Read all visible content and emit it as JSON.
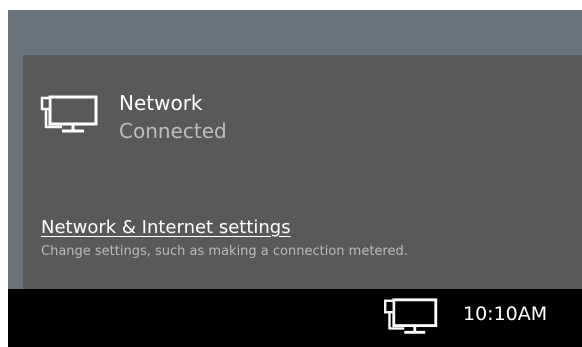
{
  "colors": {
    "desktop": "#68757f",
    "flyout": "#595959",
    "taskbar": "#000000",
    "text_primary": "#ffffff",
    "text_secondary": "#bdbdbd"
  },
  "flyout": {
    "network": {
      "icon": "wired-network-icon",
      "name": "Network",
      "status": "Connected"
    },
    "settings": {
      "link_label": "Network & Internet settings",
      "description": "Change settings, such as making a connection metered."
    }
  },
  "taskbar": {
    "tray_icon": "wired-network-icon",
    "clock": "10:10AM"
  }
}
